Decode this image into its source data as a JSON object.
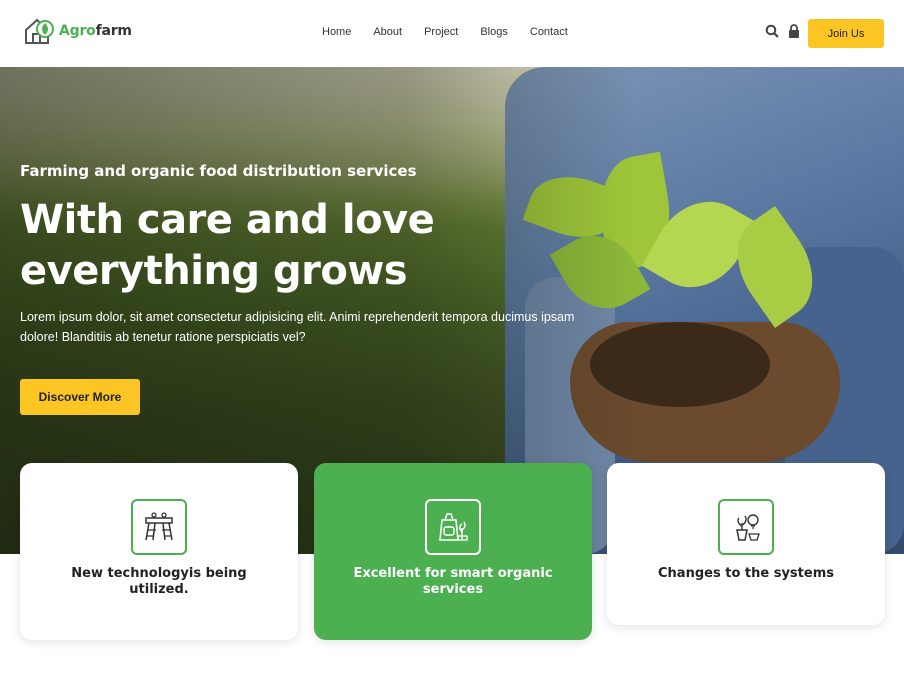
{
  "header": {
    "logo": {
      "part1": "Agro",
      "part2": "farm"
    },
    "nav": [
      "Home",
      "About",
      "Project",
      "Blogs",
      "Contact"
    ],
    "join_label": "Join Us"
  },
  "hero": {
    "kicker": "Farming and organic food distribution services",
    "headline_line1": "With care and love",
    "headline_line2": "everything grows",
    "lead": "Lorem ipsum dolor, sit amet consectetur adipisicing elit. Animi reprehenderit tempora ducimus ipsam dolore! Blanditiis ab tenetur ratione perspiciatis vel?",
    "cta": "Discover More"
  },
  "cards": [
    {
      "title": "New technologyis being utilized.",
      "icon": "technology-icon"
    },
    {
      "title": "Excellent for smart organic services",
      "icon": "organic-bag-icon"
    },
    {
      "title": "Changes to the systems",
      "icon": "plant-system-icon"
    }
  ],
  "colors": {
    "accent": "#fbc524",
    "brand_green": "#4caf50"
  }
}
